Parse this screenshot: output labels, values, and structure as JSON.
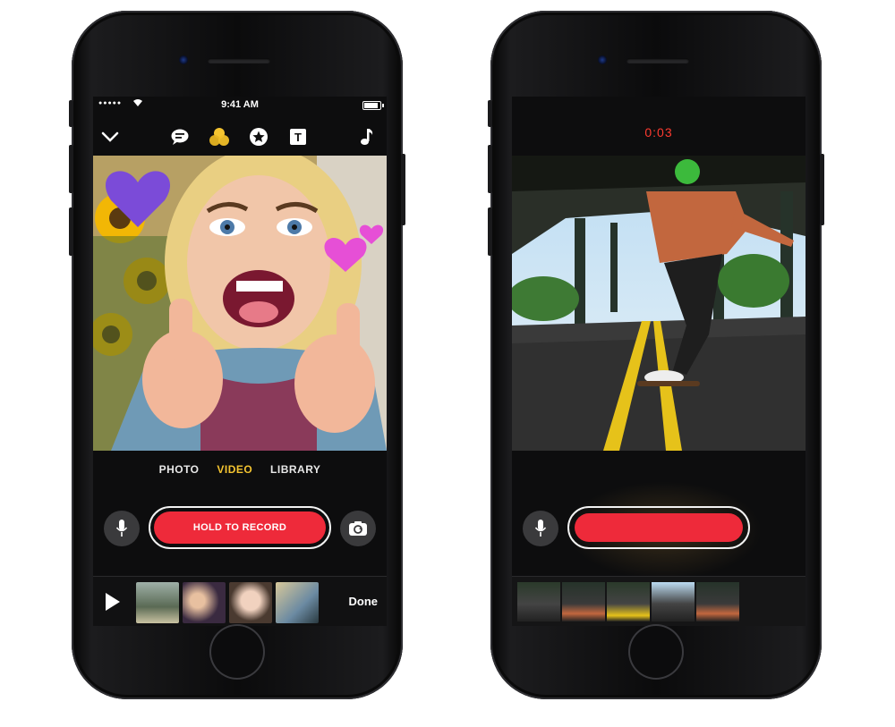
{
  "status_bar": {
    "time": "9:41 AM",
    "signal_dots": "●●●●●"
  },
  "left_screen": {
    "toolbar": {
      "icons": [
        "chevron-down-icon",
        "speech-bubble-icon",
        "filters-icon",
        "star-icon",
        "text-icon",
        "music-note-icon"
      ],
      "text_icon_glyph": "T"
    },
    "modes": {
      "photo": "PHOTO",
      "video": "VIDEO",
      "library": "LIBRARY",
      "active": "VIDEO"
    },
    "record_label": "HOLD TO RECORD",
    "done_label": "Done",
    "accent_color": "#f4c430",
    "record_color": "#ee2a3a"
  },
  "right_screen": {
    "timer": "0:03",
    "timer_color": "#ff3b30"
  }
}
